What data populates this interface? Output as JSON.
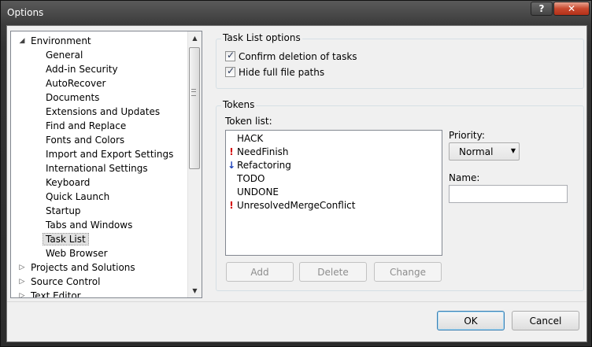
{
  "window": {
    "title": "Options",
    "help_label": "?",
    "close_label": "✕"
  },
  "tree": {
    "items": [
      {
        "label": "Environment",
        "level": 0,
        "expander": "◢"
      },
      {
        "label": "General",
        "level": 1
      },
      {
        "label": "Add-in Security",
        "level": 1
      },
      {
        "label": "AutoRecover",
        "level": 1
      },
      {
        "label": "Documents",
        "level": 1
      },
      {
        "label": "Extensions and Updates",
        "level": 1
      },
      {
        "label": "Find and Replace",
        "level": 1
      },
      {
        "label": "Fonts and Colors",
        "level": 1
      },
      {
        "label": "Import and Export Settings",
        "level": 1
      },
      {
        "label": "International Settings",
        "level": 1
      },
      {
        "label": "Keyboard",
        "level": 1
      },
      {
        "label": "Quick Launch",
        "level": 1
      },
      {
        "label": "Startup",
        "level": 1
      },
      {
        "label": "Tabs and Windows",
        "level": 1
      },
      {
        "label": "Task List",
        "level": 1,
        "selected": true
      },
      {
        "label": "Web Browser",
        "level": 1
      },
      {
        "label": "Projects and Solutions",
        "level": 0,
        "expander": "▷"
      },
      {
        "label": "Source Control",
        "level": 0,
        "expander": "▷"
      },
      {
        "label": "Text Editor",
        "level": 0,
        "expander": "▷"
      }
    ],
    "scroll_up": "▲",
    "scroll_down": "▼"
  },
  "task_list_options": {
    "title": "Task List options",
    "confirm_deletion": {
      "label": "Confirm deletion of tasks",
      "checked": true
    },
    "hide_paths": {
      "label": "Hide full file paths",
      "checked": true
    },
    "check_glyph": "✓"
  },
  "tokens": {
    "title": "Tokens",
    "list_label": "Token list:",
    "items": [
      {
        "label": "HACK",
        "icon": "",
        "priority": "normal"
      },
      {
        "label": "NeedFinish",
        "icon": "!",
        "priority": "high"
      },
      {
        "label": "Refactoring",
        "icon": "↓",
        "priority": "low"
      },
      {
        "label": "TODO",
        "icon": "",
        "priority": "normal"
      },
      {
        "label": "UNDONE",
        "icon": "",
        "priority": "normal"
      },
      {
        "label": "UnresolvedMergeConflict",
        "icon": "!",
        "priority": "high"
      }
    ],
    "priority_label": "Priority:",
    "priority_value": "Normal",
    "priority_arrow": "▼",
    "name_label": "Name:",
    "name_value": "",
    "add_label": "Add",
    "delete_label": "Delete",
    "change_label": "Change"
  },
  "footer": {
    "ok_label": "OK",
    "cancel_label": "Cancel"
  }
}
